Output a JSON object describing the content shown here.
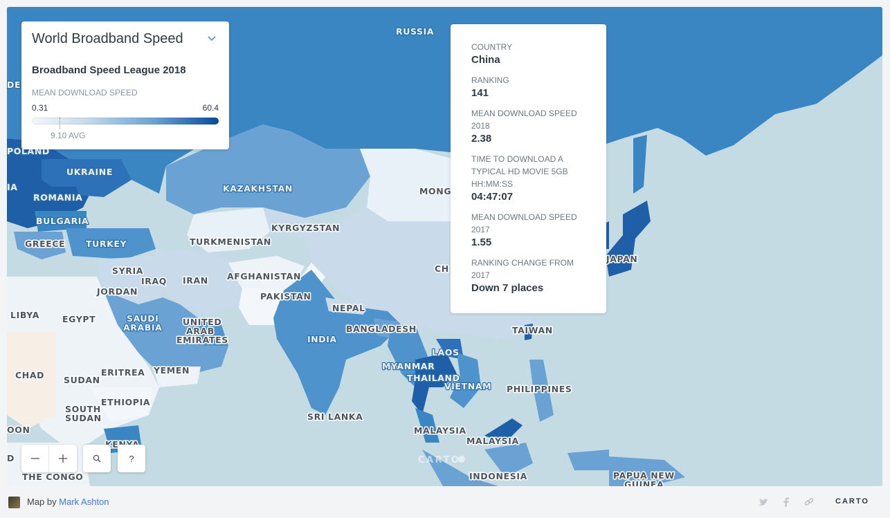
{
  "legend": {
    "title": "World Broadband Speed",
    "subtitle": "Broadband Speed League 2018",
    "variable": "MEAN DOWNLOAD SPEED",
    "min": "0.31",
    "max": "60.4",
    "avg": "9.10 AVG",
    "ramp_colors": [
      "#f3f7fc",
      "#c4d9ee",
      "#6aa3d3",
      "#0b4a9c"
    ]
  },
  "popup": {
    "fields": [
      {
        "key": "COUNTRY",
        "value": "China"
      },
      {
        "key": "RANKING",
        "value": "141"
      },
      {
        "key": "MEAN DOWNLOAD SPEED 2018",
        "value": "2.38"
      },
      {
        "key": "TIME TO DOWNLOAD A TYPICAL HD MOVIE 5GB HH:MM:SS",
        "value": "04:47:07"
      },
      {
        "key": "MEAN DOWNLOAD SPEED 2017",
        "value": "1.55"
      },
      {
        "key": "RANKING CHANGE FROM 2017",
        "value": "Down 7 places"
      }
    ]
  },
  "map": {
    "labels": [
      "RUSSIA",
      "POLAND",
      "UKRAINE",
      "ROMANIA",
      "BULGARIA",
      "GREECE",
      "TURKEY",
      "KAZAKHSTAN",
      "KYRGYZSTAN",
      "TURKMENISTAN",
      "MONGO",
      "SYRIA",
      "IRAQ",
      "IRAN",
      "AFGHANISTAN",
      "JORDAN",
      "PAKISTAN",
      "NEPAL",
      "CH",
      "JAPAN",
      "LIBYA",
      "EGYPT",
      "SAUDI",
      "ARABIA",
      "UNITED",
      "ARAB",
      "EMIRATES",
      "INDIA",
      "BANGLADESH",
      "TAIWAN",
      "LAOS",
      "MYANMAR",
      "THAILAND",
      "VIETNAM",
      "PHILIPPINES",
      "CHAD",
      "SUDAN",
      "ERITREA",
      "YEMEN",
      "ETHIOPIA",
      "SOUTH",
      "SUDAN",
      "SRI LANKA",
      "MALAYSIA",
      "MALAYSIA",
      "KENYA",
      "INDONESIA",
      "PAPUA NEW",
      "GUINEA",
      "THE CONGO",
      "DE",
      "IA",
      "OON",
      "D"
    ],
    "watermark": "CARTO",
    "colors": {
      "water": "#c5dbe3",
      "land_dark": "#1f5fa8",
      "land_mid": "#3a86c3",
      "land_light": "#c9dbea",
      "land_pale": "#e8f0f8"
    }
  },
  "controls": {
    "zoom_out_icon": "minus-icon",
    "zoom_in_icon": "plus-icon",
    "search_icon": "search-icon",
    "help_label": "?"
  },
  "footer": {
    "map_by": "Map by",
    "author": "Mark Ashton",
    "carto": "CARTO",
    "share_icons": [
      "twitter-icon",
      "facebook-icon",
      "link-icon"
    ]
  }
}
